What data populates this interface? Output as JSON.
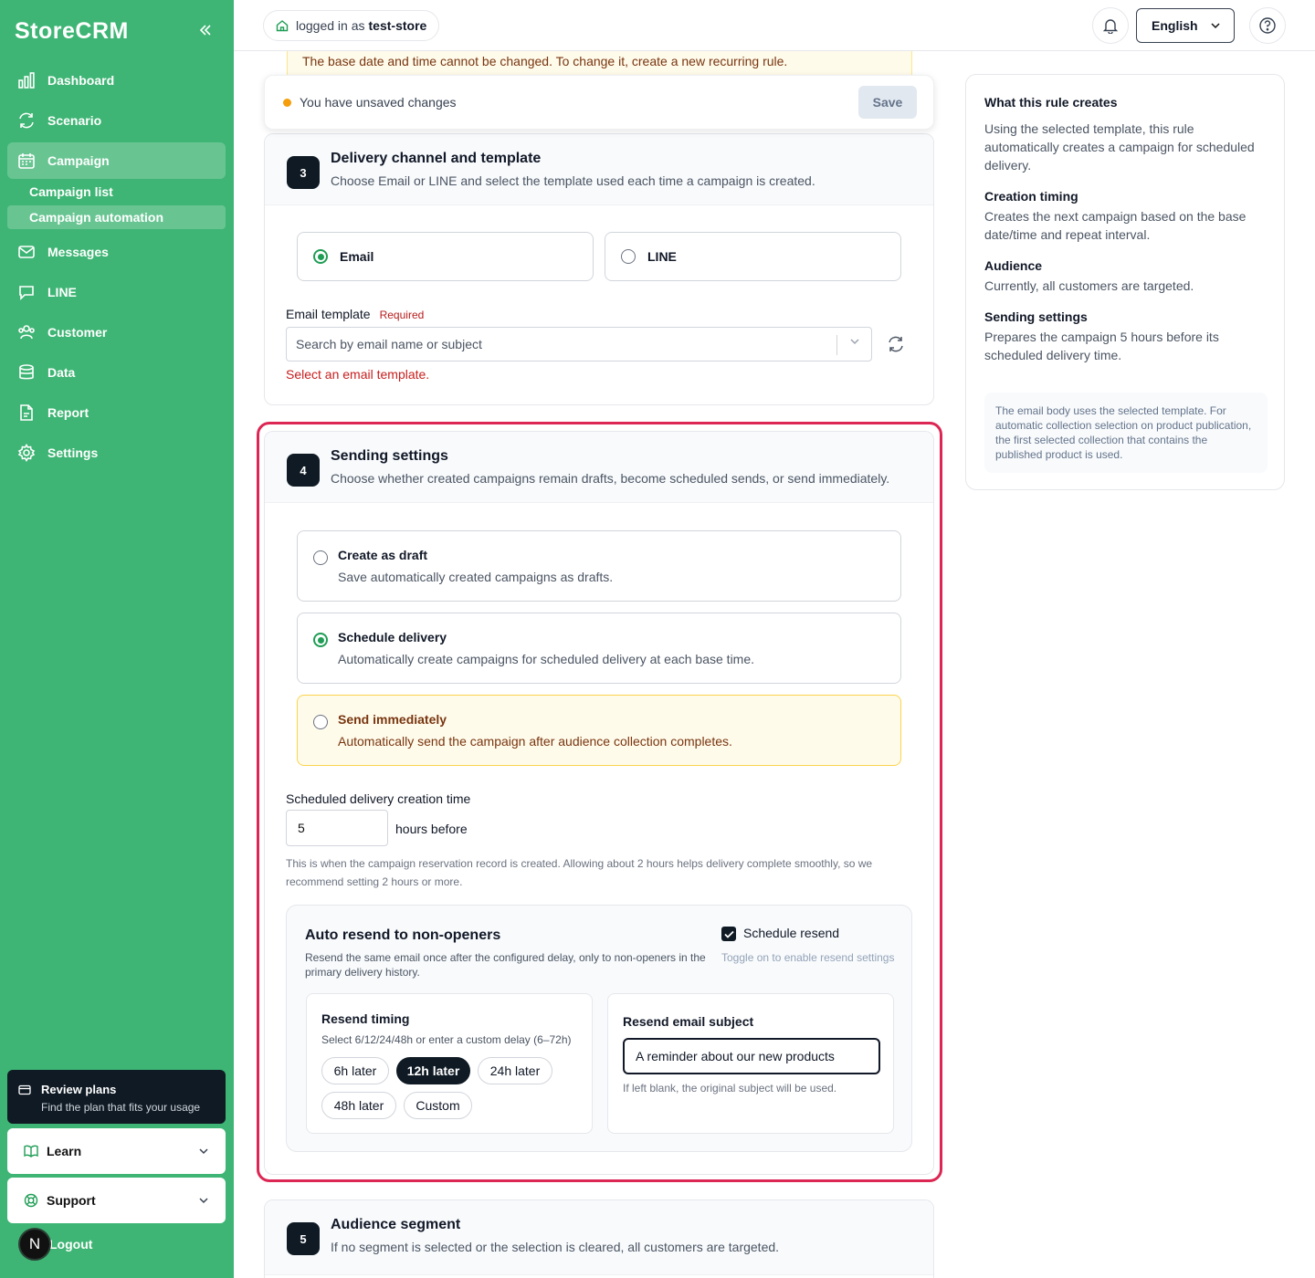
{
  "sidebar": {
    "brand": "StoreCRM",
    "items": [
      {
        "label": "Dashboard",
        "icon": "bar-chart-icon"
      },
      {
        "label": "Scenario",
        "icon": "refresh-cycle-icon"
      },
      {
        "label": "Campaign",
        "icon": "calendar-icon"
      },
      {
        "label": "Messages",
        "icon": "mail-icon"
      },
      {
        "label": "LINE",
        "icon": "chat-bubble-icon"
      },
      {
        "label": "Customer",
        "icon": "users-icon"
      },
      {
        "label": "Data",
        "icon": "database-icon"
      },
      {
        "label": "Report",
        "icon": "document-icon"
      },
      {
        "label": "Settings",
        "icon": "gear-icon"
      }
    ],
    "sub_items": [
      {
        "label": "Campaign list"
      },
      {
        "label": "Campaign automation"
      }
    ],
    "plans": {
      "title": "Review plans",
      "subtitle": "Find the plan that fits your usage"
    },
    "learn": "Learn",
    "support": "Support",
    "avatar_letter": "N",
    "logout": "Logout"
  },
  "topbar": {
    "login_prefix": "logged in as",
    "login_user": "test-store",
    "language": "English"
  },
  "warning_strip": "The base date and time cannot be changed. To change it, create a new recurring rule.",
  "unsaved": {
    "text": "You have unsaved changes",
    "save": "Save"
  },
  "section3": {
    "step": "3",
    "title": "Delivery channel and template",
    "subtitle": "Choose Email or LINE and select the template used each time a campaign is created.",
    "channels": [
      {
        "label": "Email",
        "selected": true
      },
      {
        "label": "LINE",
        "selected": false
      }
    ],
    "template_label": "Email template",
    "required": "Required",
    "template_placeholder": "Search by email name or subject",
    "error": "Select an email template."
  },
  "section4": {
    "step": "4",
    "title": "Sending settings",
    "subtitle": "Choose whether created campaigns remain drafts, become scheduled sends, or send immediately.",
    "options": [
      {
        "title": "Create as draft",
        "desc": "Save automatically created campaigns as drafts.",
        "selected": false
      },
      {
        "title": "Schedule delivery",
        "desc": "Automatically create campaigns for scheduled delivery at each base time.",
        "selected": true
      },
      {
        "title": "Send immediately",
        "desc": "Automatically send the campaign after audience collection completes.",
        "selected": false
      }
    ],
    "creation_time_label": "Scheduled delivery creation time",
    "creation_time_value": "5",
    "creation_time_unit": "hours before",
    "creation_hint_1": "This is when the campaign reservation record is created. Allowing about 2 hours helps delivery complete smoothly, so we",
    "creation_hint_2": "recommend setting 2 hours or more.",
    "resend": {
      "title": "Auto resend to non-openers",
      "desc": "Resend the same email once after the configured delay, only to non-openers in the primary delivery history.",
      "checkbox_label": "Schedule resend",
      "checked": true,
      "toggle_hint": "Toggle on to enable resend settings",
      "timing_title": "Resend timing",
      "timing_desc": "Select 6/12/24/48h or enter a custom delay (6–72h)",
      "timing_options": [
        "6h later",
        "12h later",
        "24h later",
        "48h later",
        "Custom"
      ],
      "timing_selected": "12h later",
      "subject_title": "Resend email subject",
      "subject_value": "A reminder about our new products",
      "subject_hint": "If left blank, the original subject will be used."
    }
  },
  "section5": {
    "step": "5",
    "title": "Audience segment",
    "subtitle": "If no segment is selected or the selection is cleared, all customers are targeted."
  },
  "right_panel": {
    "title": "What this rule creates",
    "intro": "Using the selected template, this rule automatically creates a campaign for scheduled delivery.",
    "sections": [
      {
        "heading": "Creation timing",
        "text": "Creates the next campaign based on the base date/time and repeat interval."
      },
      {
        "heading": "Audience",
        "text": "Currently, all customers are targeted."
      },
      {
        "heading": "Sending settings",
        "text": "Prepares the campaign 5 hours before its scheduled delivery time."
      }
    ],
    "note": "The email body uses the selected template. For automatic collection selection on product publication, the first selected collection that contains the published product is used."
  },
  "colors": {
    "sidebar": "#3eb574",
    "accent_dark": "#0f1a24",
    "error": "#c81e1e",
    "highlight": "#dc2654"
  }
}
